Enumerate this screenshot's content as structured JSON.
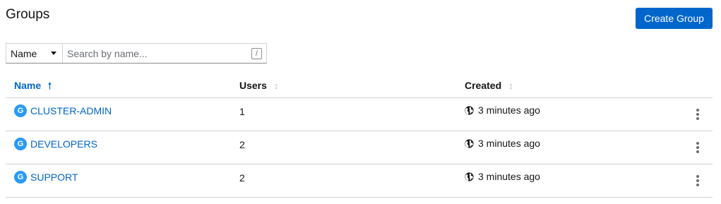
{
  "header": {
    "title": "Groups",
    "create_label": "Create Group"
  },
  "toolbar": {
    "filter_label": "Name",
    "search_placeholder": "Search by name...",
    "shortcut_hint": "/"
  },
  "table": {
    "columns": [
      "Name",
      "Users",
      "Created"
    ],
    "sorted_column": "Name",
    "sort_direction": "ascending",
    "rows": [
      {
        "badge": "G",
        "name": "CLUSTER-ADMIN",
        "users": "1",
        "created": "3 minutes ago"
      },
      {
        "badge": "G",
        "name": "DEVELOPERS",
        "users": "2",
        "created": "3 minutes ago"
      },
      {
        "badge": "G",
        "name": "SUPPORT",
        "users": "2",
        "created": "3 minutes ago"
      }
    ]
  },
  "colors": {
    "primary": "#0066cc",
    "badge": "#2b9af3",
    "border": "#d2d2d2"
  },
  "icons": {
    "sort_active": "arrow-up-icon",
    "sort_inactive": "sort-arrows-icon",
    "created": "globe-icon",
    "row_menu": "kebab-icon",
    "filter_toggle": "caret-down-icon"
  }
}
